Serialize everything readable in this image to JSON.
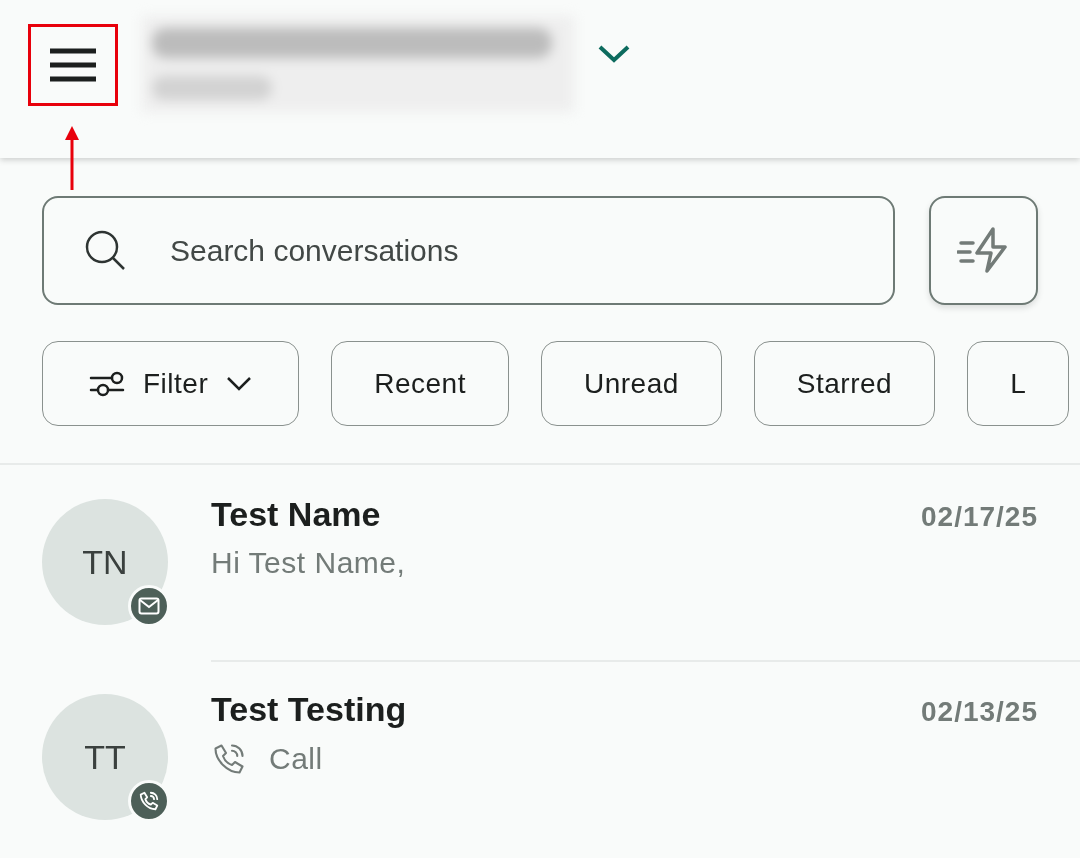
{
  "header": {
    "menu_highlighted": true
  },
  "search": {
    "placeholder": "Search conversations"
  },
  "chips": [
    {
      "label": "Filter",
      "kind": "dropdown"
    },
    {
      "label": "Recent",
      "kind": "plain"
    },
    {
      "label": "Unread",
      "kind": "plain"
    },
    {
      "label": "Starred",
      "kind": "plain"
    },
    {
      "label": "L",
      "kind": "plain"
    }
  ],
  "conversations": [
    {
      "initials": "TN",
      "name": "Test Name",
      "date": "02/17/25",
      "preview": "Hi Test Name,",
      "kind": "email"
    },
    {
      "initials": "TT",
      "name": "Test Testing",
      "date": "02/13/25",
      "preview": "Call",
      "kind": "call"
    }
  ]
}
